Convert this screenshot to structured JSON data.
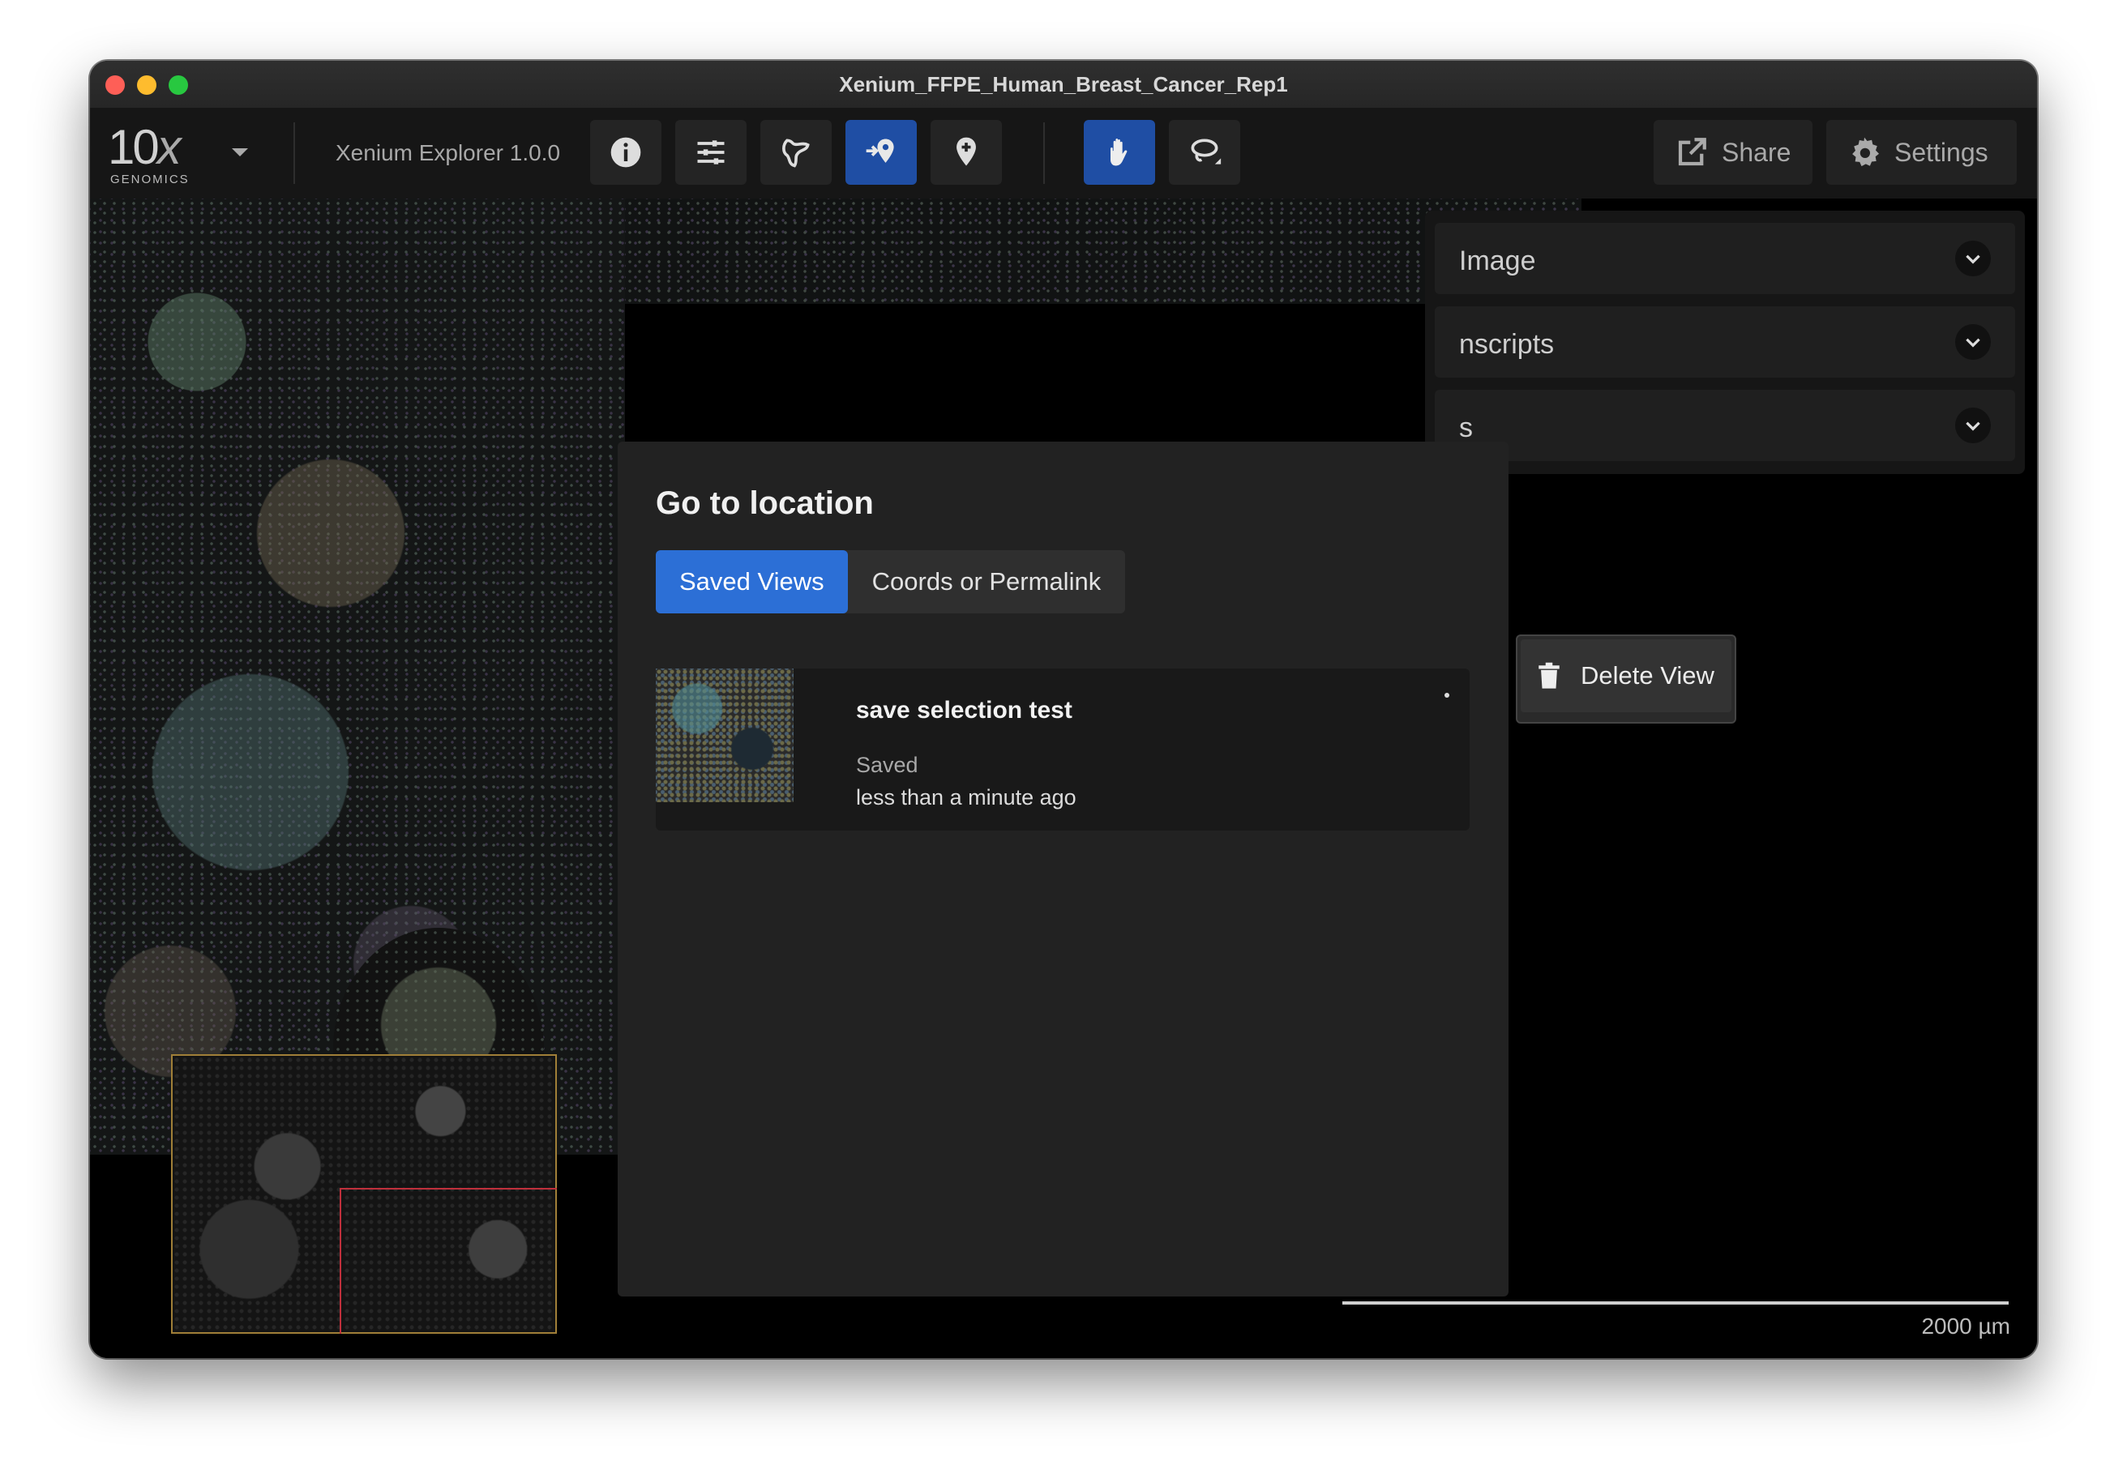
{
  "window": {
    "title": "Xenium_FFPE_Human_Breast_Cancer_Rep1"
  },
  "toolbar": {
    "logo_main": "10",
    "logo_x": "x",
    "logo_sub": "GENOMICS",
    "version": "Xenium Explorer 1.0.0",
    "share_label": "Share",
    "settings_label": "Settings"
  },
  "panel": {
    "sections": [
      {
        "label": "Image"
      },
      {
        "label": "nscripts"
      },
      {
        "label": "s"
      }
    ]
  },
  "modal": {
    "title": "Go to location",
    "tabs": [
      {
        "label": "Saved Views",
        "active": true
      },
      {
        "label": "Coords or Permalink",
        "active": false
      }
    ],
    "saved_view": {
      "name": "save selection test",
      "status": "Saved",
      "time": "less than a minute ago"
    }
  },
  "context_menu": {
    "delete_label": "Delete View"
  },
  "scale": {
    "label": "2000 µm"
  },
  "colors": {
    "accent": "#2c6fd6",
    "active_tool": "#1f4ea4"
  }
}
